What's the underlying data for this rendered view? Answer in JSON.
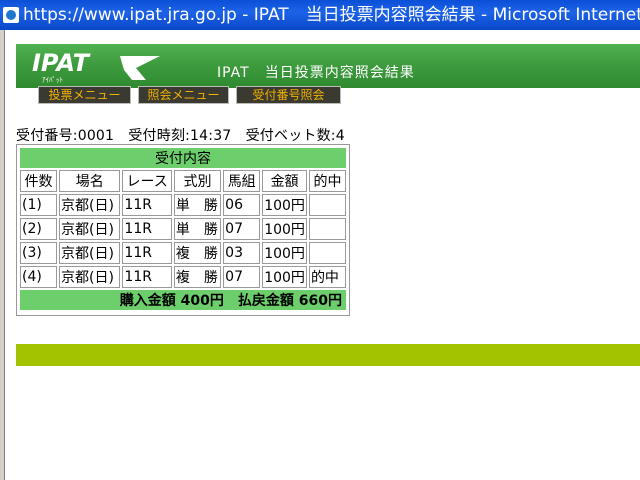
{
  "window": {
    "title": "https://www.ipat.jra.go.jp - IPAT　当日投票内容照会結果 - Microsoft Internet Explorer"
  },
  "header": {
    "logo_text": "IPAT",
    "logo_subtext": "ｱｲﾊﾟｯﾄ",
    "title": "IPAT　当日投票内容照会結果"
  },
  "nav": {
    "items": [
      {
        "label": "投票メニュー"
      },
      {
        "label": "照会メニュー"
      },
      {
        "label": "受付番号照会"
      }
    ]
  },
  "info": {
    "text": "受付番号:0001　受付時刻:14:37　受付ベット数:4"
  },
  "bets": {
    "caption": "受付内容",
    "columns": [
      "件数",
      "場名",
      "レース",
      "式別",
      "馬組",
      "金額",
      "的中"
    ],
    "rows": [
      [
        "(1)",
        "京都(日)",
        "11R",
        "単　勝",
        "06",
        "100円",
        ""
      ],
      [
        "(2)",
        "京都(日)",
        "11R",
        "単　勝",
        "07",
        "100円",
        ""
      ],
      [
        "(3)",
        "京都(日)",
        "11R",
        "複　勝",
        "03",
        "100円",
        ""
      ],
      [
        "(4)",
        "京都(日)",
        "11R",
        "複　勝",
        "07",
        "100円",
        "的中"
      ]
    ],
    "total": "購入金額 400円　払戻金額 660円"
  },
  "colors": {
    "header_green": "#3d9a3d",
    "table_green": "#6ccf6c",
    "bottom_band": "#a3c300",
    "nav_text": "#f2b200"
  }
}
